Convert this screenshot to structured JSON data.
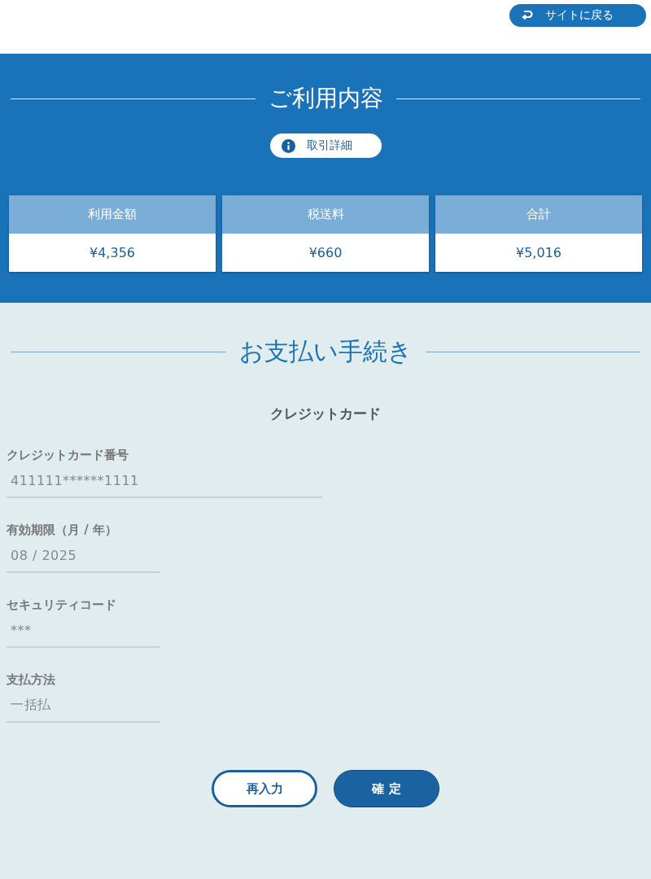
{
  "back_button": {
    "label": "サイトに戻る"
  },
  "usage": {
    "title": "ご利用内容",
    "detail_button": {
      "label": "取引詳細"
    },
    "summary": [
      {
        "label": "利用金額",
        "value": "¥4,356"
      },
      {
        "label": "税送料",
        "value": "¥660"
      },
      {
        "label": "合計",
        "value": "¥5,016"
      }
    ]
  },
  "payment": {
    "title": "お支払い手続き",
    "method": "クレジットカード",
    "fields": [
      {
        "label": "クレジットカード番号",
        "value": "411111******1111",
        "kind": "wide"
      },
      {
        "label": "有効期限（月 / 年）",
        "value": "08 / 2025",
        "kind": "narrow"
      },
      {
        "label": "セキュリティコード",
        "value": "***",
        "kind": "narrow"
      },
      {
        "label": "支払方法",
        "value": "一括払",
        "kind": "narrow"
      }
    ],
    "buttons": [
      {
        "label": "再入力",
        "kind": "secondary"
      },
      {
        "label": "確 定",
        "kind": "primary"
      }
    ]
  }
}
